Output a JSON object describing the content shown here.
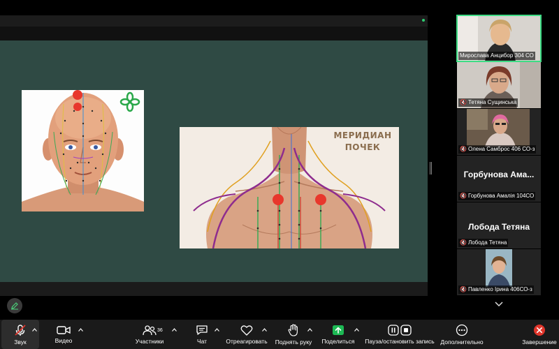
{
  "slide": {
    "face_image": "acupuncture-face-points-image",
    "meridian_title_line1": "МЕРИДИАН",
    "meridian_title_line2": "ПОЧЕК",
    "meridian_image": "kidney-meridian-chest-image"
  },
  "participants": [
    {
      "name": "Мирослава Анцибор 304 СО",
      "muted": false,
      "video": true,
      "active": true
    },
    {
      "name": "Тетяна Сущинська",
      "muted": true,
      "video": true
    },
    {
      "name": "Олена Самброс 406 СО-з",
      "muted": true,
      "video": true
    },
    {
      "name": "Горбунова Амалія 104СО",
      "display": "Горбунова Ама...",
      "muted": true,
      "video": false
    },
    {
      "name": "Лобода Тетяна",
      "display": "Лобода Тетяна",
      "muted": true,
      "video": false
    },
    {
      "name": "Павленко Ірина 406СО-з",
      "muted": true,
      "video": true
    }
  ],
  "toolbar": {
    "audio": "Звук",
    "video": "Видео",
    "participants": "Участники",
    "participants_count": "36",
    "chat": "Чат",
    "react": "Отреагировать",
    "raise_hand": "Поднять руку",
    "share": "Поделиться",
    "record": "Пауза/остановить запись",
    "more": "Дополнительно",
    "end": "Завершение"
  },
  "colors": {
    "slide_bg": "#2f4a44",
    "active_border": "#3ddc84",
    "share_green": "#1db954",
    "end_red": "#e0352b",
    "meridian_dot": "#e8372c"
  }
}
